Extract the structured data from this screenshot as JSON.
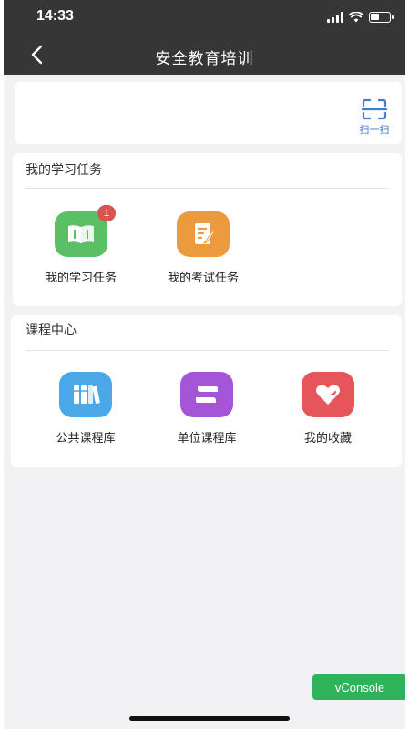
{
  "status_bar": {
    "time": "14:33"
  },
  "nav": {
    "title": "安全教育培训",
    "back_icon": "chevron-left-icon"
  },
  "scan": {
    "label": "扫一扫",
    "icon": "scan-icon",
    "color": "#3e7dd6"
  },
  "tasks": {
    "title": "我的学习任务",
    "items": [
      {
        "label": "我的学习任务",
        "icon": "book-icon",
        "color": "#5bbf66",
        "badge": "1"
      },
      {
        "label": "我的考试任务",
        "icon": "exam-paper-icon",
        "color": "#ec9a3e"
      }
    ]
  },
  "courses": {
    "title": "课程中心",
    "items": [
      {
        "label": "公共课程库",
        "icon": "books-icon",
        "color": "#4aa8e8"
      },
      {
        "label": "单位课程库",
        "icon": "library-icon",
        "color": "#a455d8"
      },
      {
        "label": "我的收藏",
        "icon": "heart-icon",
        "color": "#e5555a"
      }
    ]
  },
  "vconsole": {
    "label": "vConsole"
  }
}
